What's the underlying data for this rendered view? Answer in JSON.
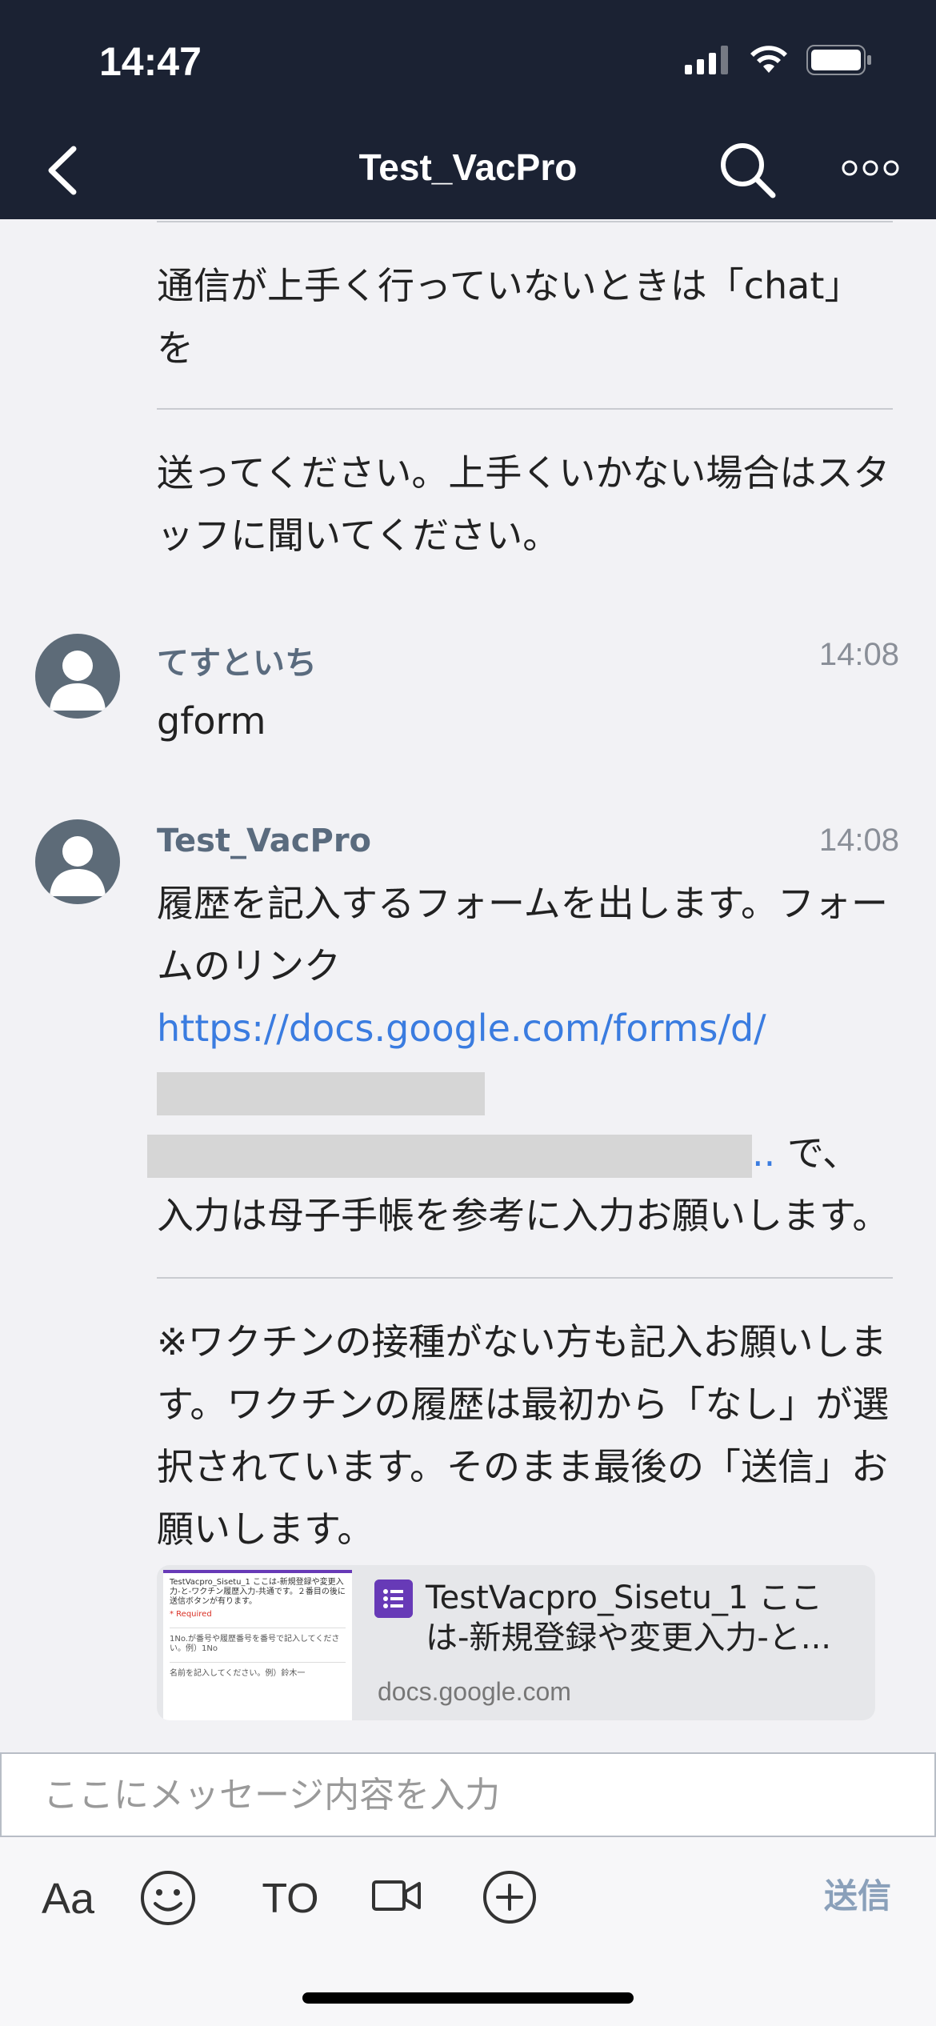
{
  "status": {
    "time": "14:47"
  },
  "nav": {
    "title": "Test_VacPro"
  },
  "messages": {
    "continued_1": "通信が上手く行っていないときは「chat」を",
    "continued_2": "送ってください。上手くいかない場合はスタッフに聞いてください。",
    "msg1": {
      "sender": "てすといち",
      "time": "14:08",
      "text": "gform"
    },
    "msg2": {
      "sender": "Test_VacPro",
      "time": "14:08",
      "text_a": "履歴を記入するフォームを出します。フォームのリンク ",
      "link": "https://docs.google.com/forms/d/",
      "link_tail": "..",
      "text_b": " で、入力は母子手帳を参考に入力お願いします。",
      "text_c": "※ワクチンの接種がない方も記入お願いします。ワクチンの履歴は最初から「なし」が選択されています。そのまま最後の「送信」お願いします。"
    }
  },
  "preview": {
    "title": "TestVacpro_Sisetu_1 ここは-新規登録や変更入力-と...",
    "domain": "docs.google.com",
    "thumb_text": "TestVacpro_Sisetu_1 ここは-新規登録や変更入力-と-ワクチン履歴入力-共通です。２番目の後に送信ボタンが有ります。",
    "thumb_required": "* Required",
    "thumb_field_1": "1No.が番号や履歴番号を番号で記入してください。例）1No",
    "thumb_field_2": "名前を記入してください。例）鈴木一"
  },
  "input": {
    "placeholder": "ここにメッセージ内容を入力"
  },
  "toolbar": {
    "font_label": "Aa",
    "to_label": "TO",
    "send_label": "送信"
  },
  "colors": {
    "header_bg": "#1b2233",
    "link": "#3a7ce0",
    "send": "#8aa0ba"
  }
}
